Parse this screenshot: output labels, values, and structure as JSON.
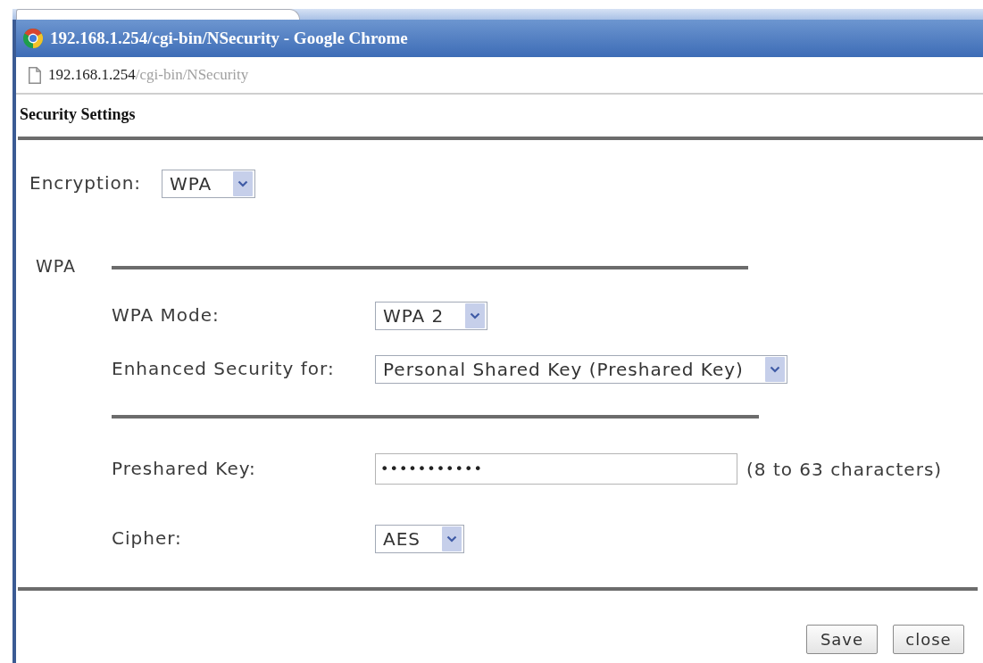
{
  "window": {
    "title": "192.168.1.254/cgi-bin/NSecurity - Google Chrome"
  },
  "address_bar": {
    "host": "192.168.1.254",
    "path": "/cgi-bin/NSecurity"
  },
  "page": {
    "heading": "Security Settings"
  },
  "encryption": {
    "label": "Encryption:",
    "value": "WPA"
  },
  "wpa_section": {
    "legend": "WPA",
    "fields": [
      {
        "kind": "select",
        "label": "WPA Mode:",
        "value": "WPA 2"
      },
      {
        "kind": "select",
        "label": "Enhanced Security for:",
        "value": "Personal Shared Key (Preshared Key)"
      },
      {
        "kind": "divider"
      },
      {
        "kind": "password",
        "label": "Preshared Key:",
        "value": "•••••••••••",
        "hint": "(8 to 63 characters)"
      },
      {
        "kind": "select",
        "label": "Cipher:",
        "value": "AES"
      }
    ]
  },
  "buttons": [
    "Save",
    "close"
  ]
}
